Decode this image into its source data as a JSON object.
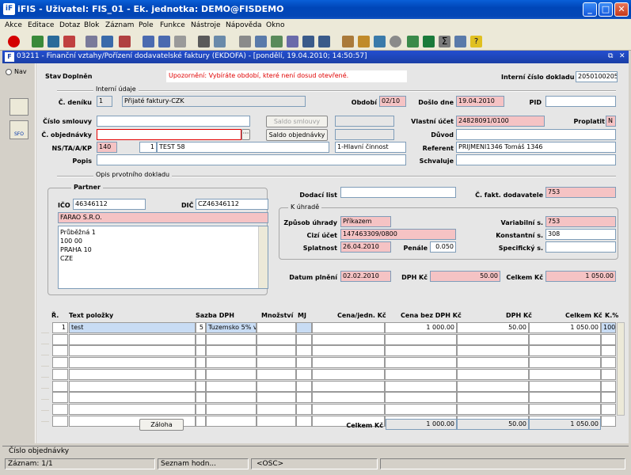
{
  "window": {
    "title": "iFIS - Uživatel: FIS_01 - Ek. jednotka: DEMO@FISDEMO"
  },
  "menu": [
    "Akce",
    "Editace",
    "Dotaz",
    "Blok",
    "Záznam",
    "Pole",
    "Funkce",
    "Nástroje",
    "Nápověda",
    "Okno"
  ],
  "form": {
    "title": "03211 - Finanční vztahy/Pořízení dodavatelské faktury (EKDOFA) - [pondělí, 19.04.2010; 14:50:57]",
    "nav": "Nav"
  },
  "header": {
    "stav_label": "Stav",
    "stav_value": "Doplněn",
    "warning": "Upozornění: Vybíráte období, které není dosud otevřené.",
    "interni_cislo_label": "Interní číslo dokladu",
    "interni_cislo": "2050100205"
  },
  "interni": {
    "section": "Interní údaje",
    "cdeniku_label": "Č. deníku",
    "cdeniku": "1",
    "cdeniku_name": "Přijaté faktury-CZK",
    "obdobi_label": "Období",
    "obdobi": "02/10",
    "doslo_label": "Došlo dne",
    "doslo": "19.04.2010",
    "pid_label": "PID",
    "pid": "",
    "cislo_smlouvy_label": "Číslo smlouvy",
    "cislo_smlouvy": "",
    "saldo_smlouvy": "Saldo smlouvy",
    "vlastni_ucet_label": "Vlastní účet",
    "vlastni_ucet": "24828091/0100",
    "proplatit_label": "Proplatit",
    "proplatit": "N",
    "objednavky_label": "Č. objednávky",
    "objednavky": "",
    "saldo_objednavky": "Saldo objednávky",
    "duvod_label": "Důvod",
    "duvod": "",
    "nsta_label": "NS/TA/A/KP",
    "ns": "140",
    "ta": "1",
    "a": "TEST 58",
    "kp": "1-Hlavní činnost",
    "referent_label": "Referent",
    "referent": "PRIJMENI1346 Tomáš 1346",
    "popis_label": "Popis",
    "popis": "",
    "schvaluje_label": "Schvaluje",
    "schvaluje": ""
  },
  "opis": {
    "section": "Opis prvotního dokladu",
    "partner_label": "Partner",
    "ico_label": "IČO",
    "ico": "46346112",
    "dic_label": "DIČ",
    "dic": "CZ46346112",
    "name": "FARAO S.R.O.",
    "address": [
      "Průběžná 1",
      "100 00",
      "PRAHA 10",
      "CZE"
    ],
    "dodaci_label": "Dodací list",
    "dodaci": "",
    "cfakt_label": "Č. fakt. dodavatele",
    "cfakt": "753",
    "kuhrade_label": "K úhradě",
    "zpusob_label": "Způsob úhrady",
    "zpusob": "Příkazem",
    "variab_label": "Variabilní s.",
    "variab": "753",
    "cizi_label": "Cizí účet",
    "cizi": "147463309/0800",
    "konst_label": "Konstantní s.",
    "konst": "308",
    "splatnost_label": "Splatnost",
    "splatnost": "26.04.2010",
    "penale_label": "Penále",
    "penale": "0.050",
    "specif_label": "Specifický s.",
    "specif": "",
    "datum_label": "Datum plnění",
    "datum": "02.02.2010",
    "dph_label": "DPH Kč",
    "dph": "50.00",
    "celkem_label": "Celkem Kč",
    "celkem": "1 050.00"
  },
  "items": {
    "headers": [
      "Ř.",
      "Text položky",
      "Sazba DPH",
      "Množství",
      "MJ",
      "Cena/jedn. Kč",
      "Cena bez DPH Kč",
      "DPH Kč",
      "Celkem Kč",
      "K.%"
    ],
    "rows": [
      {
        "r": "1",
        "text": "test",
        "sazba": "5",
        "sazba_text": "Tuzemsko 5% v",
        "mnozstvi": "",
        "mj": "",
        "cena_jedn": "",
        "cena_bez": "1 000.00",
        "dph": "50.00",
        "celkem": "1 050.00",
        "k": "100"
      }
    ],
    "empty_rows": 8,
    "zaloha": "Záloha",
    "celkem_label": "Celkem Kč",
    "sum_bez": "1 000.00",
    "sum_dph": "50.00",
    "sum_celkem": "1 050.00"
  },
  "status": {
    "hint": "Číslo objednávky",
    "zaznam": "Záznam: 1/1",
    "seznam": "Seznam hodn...",
    "osc": "<OSC>"
  }
}
